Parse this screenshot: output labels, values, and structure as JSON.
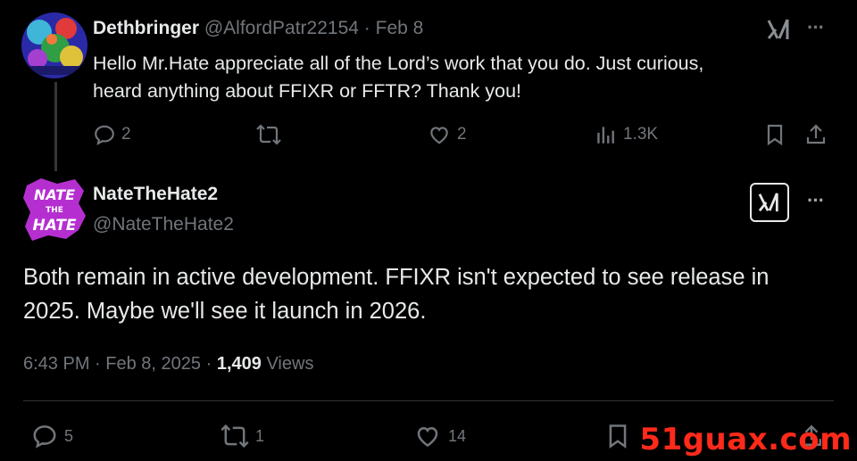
{
  "reply_tweet": {
    "display_name": "Dethbringer",
    "handle": "@AlfordPatr22154",
    "separator": "·",
    "date": "Feb 8",
    "text_line1": "Hello Mr.Hate appreciate all of the Lord’s work that you do. Just curious,",
    "text_line2": "heard anything about FFIXR or FFTR? Thank you!",
    "replies": "2",
    "retweets": "",
    "likes": "2",
    "views": "1.3K"
  },
  "main_tweet": {
    "display_name": "NateTheHate2",
    "handle": "@NateTheHate2",
    "text_line1": "Both remain in active development. FFIXR isn't expected to see release in",
    "text_line2": "2025. Maybe we'll see it launch in 2026.",
    "time": "6:43 PM",
    "separator": "·",
    "date": "Feb 8, 2025",
    "separator2": "·",
    "views_count": "1,409",
    "views_label": "Views",
    "replies": "5",
    "retweets": "1",
    "likes": "14"
  },
  "avatar_text": {
    "line1": "NATE",
    "line2": "THE",
    "line3": "HATE"
  },
  "more_glyph": "···",
  "watermark": "51guax.com",
  "colors": {
    "background": "#000000",
    "text": "#e7e9ea",
    "muted": "#71767b",
    "avatar_purple": "#b52fd0",
    "watermark": "#ff2a1a"
  }
}
